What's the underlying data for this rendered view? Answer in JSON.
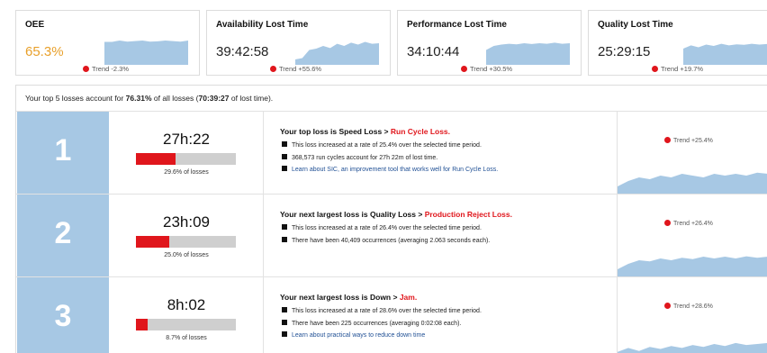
{
  "kpis": [
    {
      "title": "OEE",
      "value": "65.3%",
      "trend": "Trend -2.3%",
      "spark": [
        0.85,
        0.85,
        0.9,
        0.86,
        0.88,
        0.9,
        0.86,
        0.87,
        0.9,
        0.88,
        0.86,
        0.9
      ]
    },
    {
      "title": "Availability Lost Time",
      "value": "39:42:58",
      "trend": "Trend +55.6%",
      "spark": [
        0.2,
        0.25,
        0.55,
        0.6,
        0.7,
        0.62,
        0.78,
        0.7,
        0.82,
        0.75,
        0.85,
        0.78,
        0.8
      ]
    },
    {
      "title": "Performance Lost Time",
      "value": "34:10:44",
      "trend": "Trend +30.5%",
      "spark": [
        0.55,
        0.7,
        0.75,
        0.78,
        0.76,
        0.8,
        0.77,
        0.8,
        0.78,
        0.82,
        0.78,
        0.8
      ]
    },
    {
      "title": "Quality Lost Time",
      "value": "25:29:15",
      "trend": "Trend +19.7%",
      "spark": [
        0.6,
        0.72,
        0.65,
        0.75,
        0.7,
        0.78,
        0.72,
        0.76,
        0.74,
        0.78,
        0.75,
        0.77
      ]
    }
  ],
  "summary": {
    "prefix": "Your top 5 losses account for ",
    "pct": "76.31%",
    "mid": " of all losses (",
    "time": "70:39:27",
    "suffix": " of lost time)."
  },
  "losses": [
    {
      "rank": "1",
      "time": "27h:22",
      "share": 0.296,
      "share_label": "29.6% of losses",
      "head_prefix": "Your top loss is Speed Loss > ",
      "head_red": "Run Cycle Loss.",
      "bullets": [
        "This loss increased at a rate of 25.4% over the selected time period.",
        "368,573 run cycles account for 27h 22m of lost time."
      ],
      "link": "Learn about SIC, an improvement tool that works well for Run Cycle Loss.",
      "trend": "Trend +25.4%",
      "spark": [
        0.2,
        0.35,
        0.45,
        0.4,
        0.5,
        0.45,
        0.55,
        0.5,
        0.45,
        0.55,
        0.5,
        0.55,
        0.5,
        0.58,
        0.55
      ]
    },
    {
      "rank": "2",
      "time": "23h:09",
      "share": 0.25,
      "share_label": "25.0% of losses",
      "head_prefix": "Your next largest loss is Quality Loss > ",
      "head_red": "Production Reject Loss.",
      "bullets": [
        "This loss increased at a rate of 26.4% over the selected time period.",
        "There have been 40,409 occurrences (averaging 2.063 seconds each)."
      ],
      "link": "",
      "trend": "Trend +26.4%",
      "spark": [
        0.2,
        0.35,
        0.45,
        0.42,
        0.5,
        0.45,
        0.52,
        0.48,
        0.55,
        0.5,
        0.55,
        0.5,
        0.56,
        0.52,
        0.55
      ]
    },
    {
      "rank": "3",
      "time": "8h:02",
      "share": 0.087,
      "share_label": "8.7% of losses",
      "head_prefix": "Your next largest loss is Down > ",
      "head_red": "Jam.",
      "bullets": [
        "This loss increased at a rate of 28.6% over the selected time period.",
        "There have been 225 occurrences (averaging 0:02:08 each)."
      ],
      "link": "Learn about practical ways to reduce down time",
      "trend": "Trend +28.6%",
      "spark": [
        0.1,
        0.3,
        0.15,
        0.35,
        0.25,
        0.4,
        0.3,
        0.45,
        0.35,
        0.5,
        0.4,
        0.55,
        0.45,
        0.5,
        0.55
      ]
    }
  ],
  "colors": {
    "spark": "#a7c8e4",
    "accent_red": "#e0161c",
    "oee_value": "#e8a02b",
    "link": "#1f4f94"
  }
}
